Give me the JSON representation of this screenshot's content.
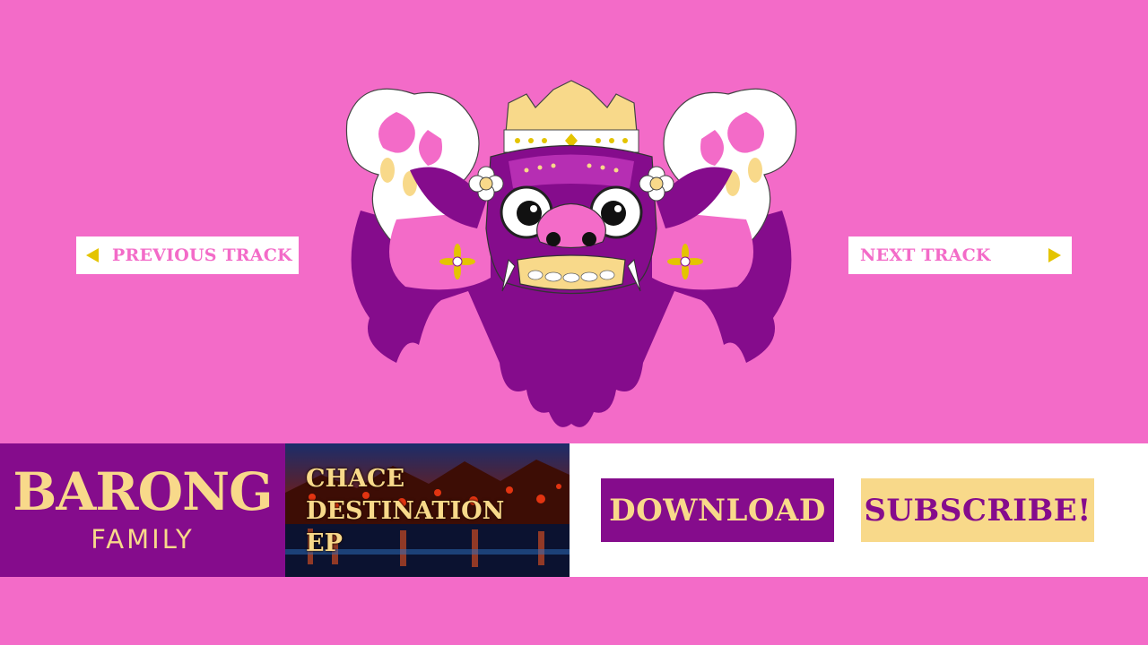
{
  "nav": {
    "previous_label": "PREVIOUS TRACK",
    "next_label": "NEXT TRACK"
  },
  "brand": {
    "name": "BARONG",
    "subtitle": "FAMILY"
  },
  "release": {
    "title_lines": [
      "CHACE",
      "DESTINATION",
      "EP"
    ]
  },
  "actions": {
    "download_label": "DOWNLOAD",
    "subscribe_label": "SUBSCRIBE!"
  },
  "colors": {
    "background": "#f36bc8",
    "purple": "#850c8c",
    "gold": "#f8d98a",
    "arrow_yellow": "#e4c400"
  },
  "icons": {
    "previous": "triangle-left-icon",
    "next": "triangle-right-icon",
    "mask": "barong-mask-logo"
  }
}
